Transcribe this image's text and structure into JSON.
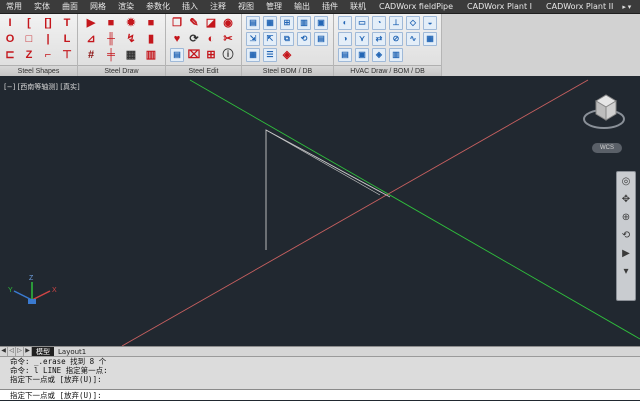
{
  "tabs": [
    "常用",
    "实体",
    "曲面",
    "网格",
    "渲染",
    "参数化",
    "插入",
    "注释",
    "视图",
    "管理",
    "输出",
    "插件",
    "联机",
    "CADWorx fieldPipe",
    "CADWorx Plant I",
    "CADWorx Plant II"
  ],
  "tab_controls": "▸ ▾",
  "panels": {
    "steel_shapes": {
      "title": "Steel Shapes"
    },
    "steel_draw": {
      "title": "Steel Draw"
    },
    "steel_edit": {
      "title": "Steel Edit"
    },
    "steel_bom": {
      "title": "Steel BOM / DB"
    },
    "hvac": {
      "title": "HVAC Draw / BOM / DB"
    }
  },
  "viewport": {
    "label": "[−] [西南等轴测] [真实]",
    "wcs_label": "WCS",
    "axis_x": "X",
    "axis_y": "Y",
    "axis_z": "Z",
    "line_colors": {
      "green": "#2fbf3c",
      "red": "#c96060",
      "white": "#c8c8c8"
    }
  },
  "layout_tabs": {
    "model": "模型",
    "layout1": "Layout1"
  },
  "command": {
    "history": [
      "命令: _.erase 找到 8 个",
      "命令: l LINE 指定第一点:",
      "指定下一点或 [放弃(U)]:"
    ],
    "input": "指定下一点或 [放弃(U)]:"
  }
}
